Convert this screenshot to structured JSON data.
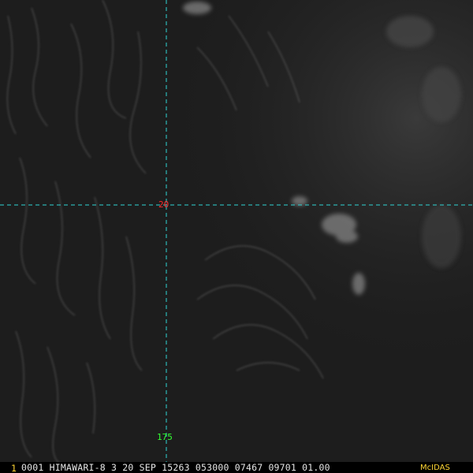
{
  "grid": {
    "latitude_label": "20",
    "longitude_label": "175",
    "line_color": "#2fd5d5",
    "latitude_label_color": "#ff2a2a",
    "longitude_label_color": "#33ff33"
  },
  "status_bar": {
    "frame_number": "1",
    "text": "0001 HIMAWARI-8   3 20 SEP 15263 053000 07467 09701 01.00",
    "brand": "McIDAS",
    "brand_color": "#ffd633"
  }
}
